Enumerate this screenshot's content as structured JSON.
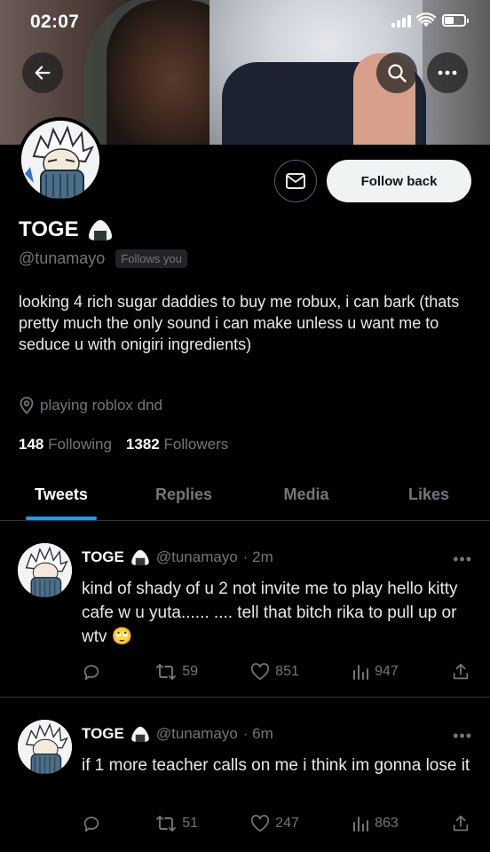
{
  "status_bar": {
    "time": "02:07"
  },
  "profile": {
    "name": "TOGE",
    "handle": "@tunamayo",
    "follows_you": "Follows you",
    "bio": "looking 4 rich sugar daddies to buy me robux, i can bark (thats pretty much the only sound i can make unless u want me to seduce u with onigiri ingredients)",
    "location": "playing roblox dnd",
    "following_count": "148",
    "following_label": "Following",
    "followers_count": "1382",
    "followers_label": "Followers",
    "follow_button": "Follow back"
  },
  "tabs": [
    {
      "label": "Tweets",
      "active": true
    },
    {
      "label": "Replies",
      "active": false
    },
    {
      "label": "Media",
      "active": false
    },
    {
      "label": "Likes",
      "active": false
    }
  ],
  "tweets": [
    {
      "name": "TOGE",
      "handle": "@tunamayo",
      "time": "· 2m",
      "text": "kind of shady of u 2 not invite me to play hello kitty cafe w u yuta...... .... tell that bitch rika to pull up or wtv 🙄",
      "retweets": "59",
      "likes": "851",
      "views": "947"
    },
    {
      "name": "TOGE",
      "handle": "@tunamayo",
      "time": "· 6m",
      "text": "if 1 more teacher calls on me i think im gonna lose it",
      "retweets": "51",
      "likes": "247",
      "views": "863"
    }
  ],
  "colors": {
    "accent": "#1d9bf0",
    "muted": "#71767b",
    "background": "#000000"
  },
  "icons": [
    "back-arrow-icon",
    "search-icon",
    "more-icon",
    "mail-icon",
    "onigiri-icon",
    "location-pin-icon",
    "reply-icon",
    "retweet-icon",
    "like-icon",
    "views-icon",
    "share-icon"
  ]
}
